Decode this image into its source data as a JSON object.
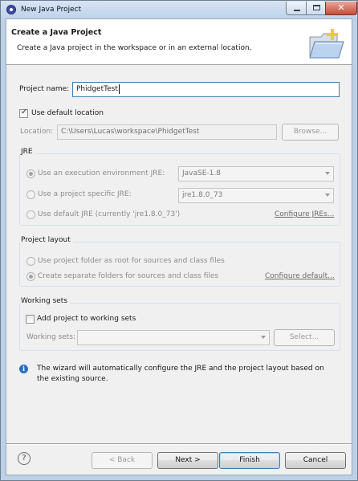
{
  "window": {
    "title": "New Java Project"
  },
  "header": {
    "title": "Create a Java Project",
    "description": "Create a Java project in the workspace or in an external location."
  },
  "project_name": {
    "label": "Project name:",
    "value": "PhidgetTest"
  },
  "location": {
    "use_default_label": "Use default location",
    "use_default_checked": true,
    "label": "Location:",
    "value": "C:\\Users\\Lucas\\workspace\\PhidgetTest",
    "browse_label": "Browse..."
  },
  "jre": {
    "title": "JRE",
    "execution_env_label": "Use an execution environment JRE:",
    "execution_env_value": "JavaSE-1.8",
    "project_specific_label": "Use a project specific JRE:",
    "project_specific_value": "jre1.8.0_73",
    "default_label": "Use default JRE (currently 'jre1.8.0_73')",
    "configure_link": "Configure JREs..."
  },
  "project_layout": {
    "title": "Project layout",
    "option_root_label": "Use project folder as root for sources and class files",
    "option_separate_label": "Create separate folders for sources and class files",
    "configure_link": "Configure default..."
  },
  "working_sets": {
    "title": "Working sets",
    "add_label": "Add project to working sets",
    "add_checked": false,
    "sets_label": "Working sets:",
    "select_label": "Select..."
  },
  "info": {
    "text": "The wizard will automatically configure the JRE and the project layout based on the existing source."
  },
  "footer": {
    "help_icon": "?",
    "back_label": "< Back",
    "next_label": "Next >",
    "finish_label": "Finish",
    "cancel_label": "Cancel"
  },
  "icons": {
    "app": "eclipse-icon",
    "header": "new-folder-wizard-icon",
    "info": "info-icon",
    "help": "help-icon"
  }
}
